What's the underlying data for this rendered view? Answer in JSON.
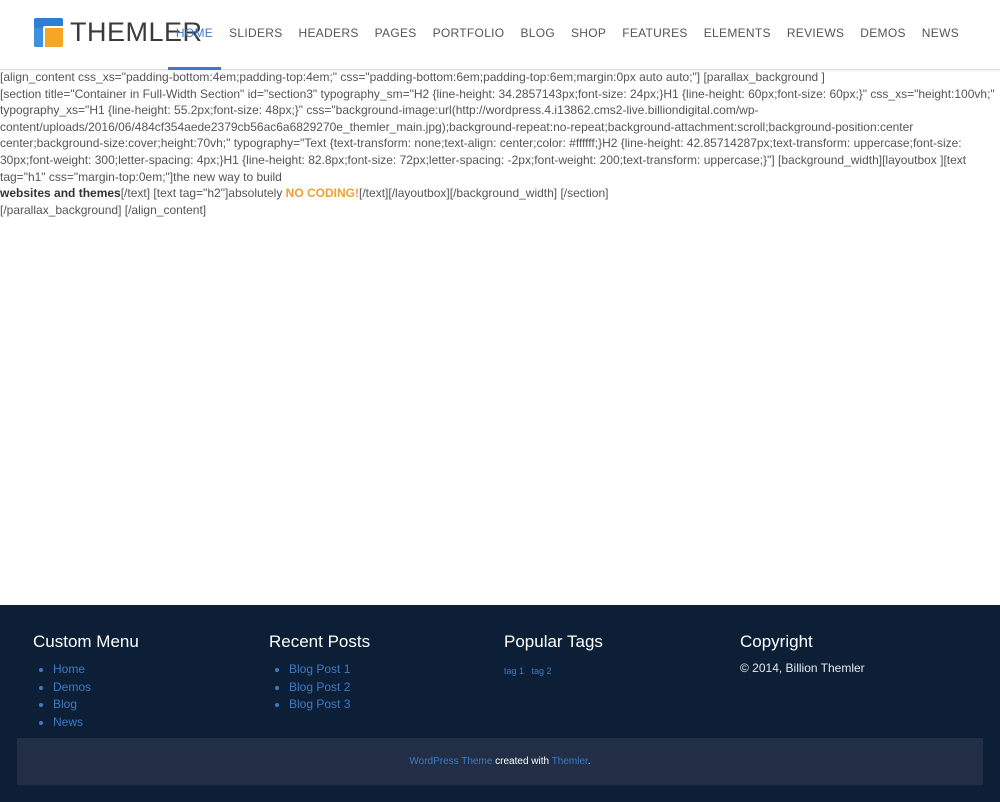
{
  "site": {
    "logo_text": "THEMLER"
  },
  "nav": {
    "items": [
      {
        "label": "HOME",
        "active": true
      },
      {
        "label": "SLIDERS"
      },
      {
        "label": "HEADERS"
      },
      {
        "label": "PAGES"
      },
      {
        "label": "PORTFOLIO"
      },
      {
        "label": "BLOG"
      },
      {
        "label": "SHOP"
      },
      {
        "label": "FEATURES"
      },
      {
        "label": "ELEMENTS"
      },
      {
        "label": "REVIEWS"
      },
      {
        "label": "DEMOS"
      },
      {
        "label": "NEWS"
      }
    ]
  },
  "content": {
    "line1": "[align_content css_xs=\"padding-bottom:4em;padding-top:4em;\" css=\"padding-bottom:6em;padding-top:6em;margin:0px auto auto;\"] [parallax_background ]",
    "line2": "[section title=\"Container in Full-Width Section\" id=\"section3\" typography_sm=\"H2 {line-height: 34.2857143px;font-size: 24px;}H1 {line-height: 60px;font-size: 60px;}\" css_xs=\"height:100vh;\" typography_xs=\"H1 {line-height: 55.2px;font-size: 48px;}\" css=\"background-image:url(http://wordpress.4.i13862.cms2-live.billiondigital.com/wp-content/uploads/2016/06/484cf354aede2379cb56ac6a6829270e_themler_main.jpg);background-repeat:no-repeat;background-attachment:scroll;background-position:center center;background-size:cover;height:70vh;\" typography=\"Text {text-transform: none;text-align: center;color: #ffffff;}H2 {line-height: 42.85714287px;text-transform: uppercase;font-size: 30px;font-weight: 300;letter-spacing: 4px;}H1 {line-height: 82.8px;font-size: 72px;letter-spacing: -2px;font-weight: 200;text-transform: uppercase;}\"] [background_width][layoutbox ][text tag=\"h1\" css=\"margin-top:0em;\"]the new way to build",
    "line3_bold": "websites and themes",
    "line3_mid": "[/text] [text tag=\"h2\"]absolutely ",
    "line3_accent": "NO CODING!",
    "line3_end": "[/text][/layoutbox][/background_width] [/section]",
    "line4": "[/parallax_background] [/align_content]"
  },
  "footer": {
    "custom_menu": {
      "title": "Custom Menu",
      "items": [
        "Home",
        "Demos",
        "Blog",
        "News"
      ]
    },
    "recent_posts": {
      "title": "Recent Posts",
      "items": [
        "Blog Post 1",
        "Blog Post 2",
        "Blog Post 3"
      ]
    },
    "popular_tags": {
      "title": "Popular Tags",
      "tags": [
        "tag 1",
        "tag 2"
      ]
    },
    "copyright": {
      "title": "Copyright",
      "text": "© 2014, Billion Themler"
    },
    "bottom": {
      "link1": "WordPress Theme",
      "middle": " created with ",
      "link2": "Themler",
      "end": "."
    }
  },
  "colors": {
    "accent": "#3e7bc4",
    "highlight": "#f0a030",
    "footer_bg": "#0c1f37",
    "footer_bar_bg": "#212e46"
  }
}
